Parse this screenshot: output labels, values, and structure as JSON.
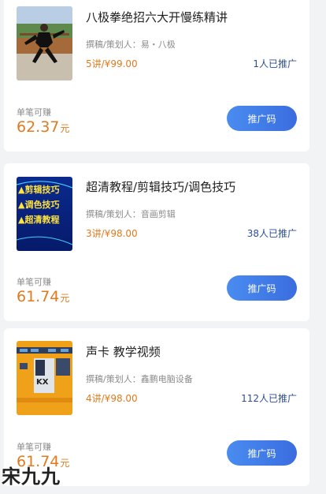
{
  "courses": [
    {
      "title": "八极拳绝招六大开慢练精讲",
      "author": "撰稿/策划人：易・八极",
      "price": "5讲/¥99.00",
      "promoted": "1人已推广",
      "earn_label": "单笔可赚",
      "earn_amount": "62.37",
      "earn_unit": "元",
      "button": "推广码",
      "thumb": "photo-martial-arts"
    },
    {
      "title": "超清教程/剪辑技巧/调色技巧",
      "author": "撰稿/策划人：音画剪辑",
      "price": "3讲/¥98.00",
      "promoted": "38人已推广",
      "earn_label": "单笔可赚",
      "earn_amount": "61.74",
      "earn_unit": "元",
      "button": "推广码",
      "thumb": "poster-video-editing",
      "thumb_text": [
        "▲剪辑技巧",
        "▲调色技巧",
        "▲超清教程"
      ]
    },
    {
      "title": "声卡 教学视频",
      "author": "撰稿/策划人：鑫鹏电脑设备",
      "price": "4讲/¥98.00",
      "promoted": "112人已推广",
      "earn_label": "单笔可赚",
      "earn_amount": "61.74",
      "earn_unit": "元",
      "button": "推广码",
      "thumb": "photo-sound-card",
      "thumb_text": [
        "KX"
      ]
    }
  ],
  "watermark": "宋九九"
}
